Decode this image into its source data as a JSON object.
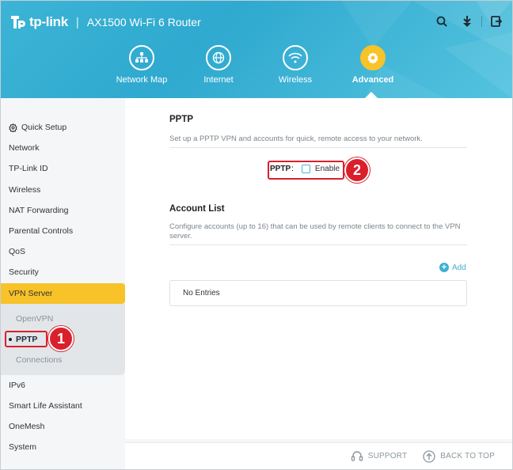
{
  "header": {
    "brand": "tp-link",
    "separator": "|",
    "model": "AX1500 Wi-Fi 6 Router",
    "icons": [
      "search-icon",
      "logout-arrow-icon",
      "reboot-icon"
    ]
  },
  "nav": {
    "items": [
      {
        "label": "Network Map",
        "icon": "network-map-icon"
      },
      {
        "label": "Internet",
        "icon": "globe-icon"
      },
      {
        "label": "Wireless",
        "icon": "wifi-icon"
      },
      {
        "label": "Advanced",
        "icon": "gear-icon"
      }
    ],
    "active": "Advanced"
  },
  "sidebar": {
    "items": [
      {
        "label": "Quick Setup",
        "icon": "gear-icon"
      },
      {
        "label": "Network"
      },
      {
        "label": "TP-Link ID"
      },
      {
        "label": "Wireless"
      },
      {
        "label": "NAT Forwarding"
      },
      {
        "label": "Parental Controls"
      },
      {
        "label": "QoS"
      },
      {
        "label": "Security"
      },
      {
        "label": "VPN Server"
      }
    ],
    "subitems": [
      {
        "label": "OpenVPN"
      },
      {
        "label": "PPTP"
      },
      {
        "label": "Connections"
      }
    ],
    "items_after": [
      {
        "label": "IPv6"
      },
      {
        "label": "Smart Life Assistant"
      },
      {
        "label": "OneMesh"
      },
      {
        "label": "System"
      }
    ]
  },
  "main": {
    "pptp_title": "PPTP",
    "pptp_desc": "Set up a PPTP VPN and accounts for quick, remote access to your network.",
    "pptp_label": "PPTP",
    "pptp_colon": ":",
    "enable_label": "Enable",
    "enable_checked": false,
    "account_title": "Account List",
    "account_desc": "Configure accounts (up to 16) that can be used by remote clients to connect to the VPN server.",
    "add_label": "Add",
    "no_entries": "No Entries"
  },
  "annotations": {
    "badge1": "1",
    "badge2": "2",
    "color": "#d9202b"
  },
  "footer": {
    "support": "SUPPORT",
    "back_to_top": "BACK TO TOP"
  },
  "colors": {
    "accent": "#3eb0d5",
    "active": "#f8c229"
  }
}
